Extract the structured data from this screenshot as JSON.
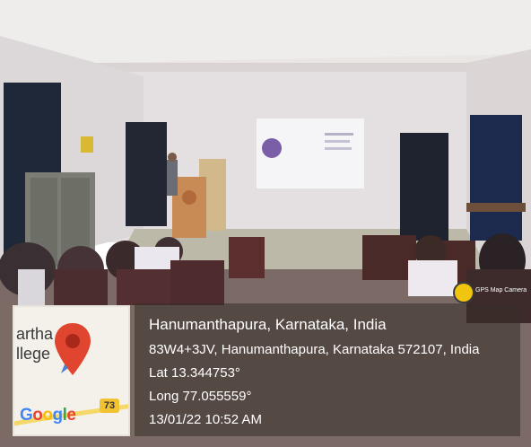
{
  "photo_description_icon": "classroom-photo",
  "location": {
    "place": "Hanumanthapura, Karnataka, India",
    "address": "83W4+3JV, Hanumanthapura, Karnataka 572107, India",
    "latitude": "Lat 13.344753°",
    "longitude": "Long 77.055559°",
    "datetime": "13/01/22 10:52 AM"
  },
  "map_thumbnail": {
    "label_partial_1": "artha",
    "label_partial_2": "llege",
    "provider_logo": "Google",
    "road_number": "73"
  },
  "app_badge": {
    "label": "GPS Map Camera"
  },
  "colors": {
    "overlay_text": "#ffffff",
    "map_pin": "#e0452f",
    "road_badge": "#f2c230"
  }
}
